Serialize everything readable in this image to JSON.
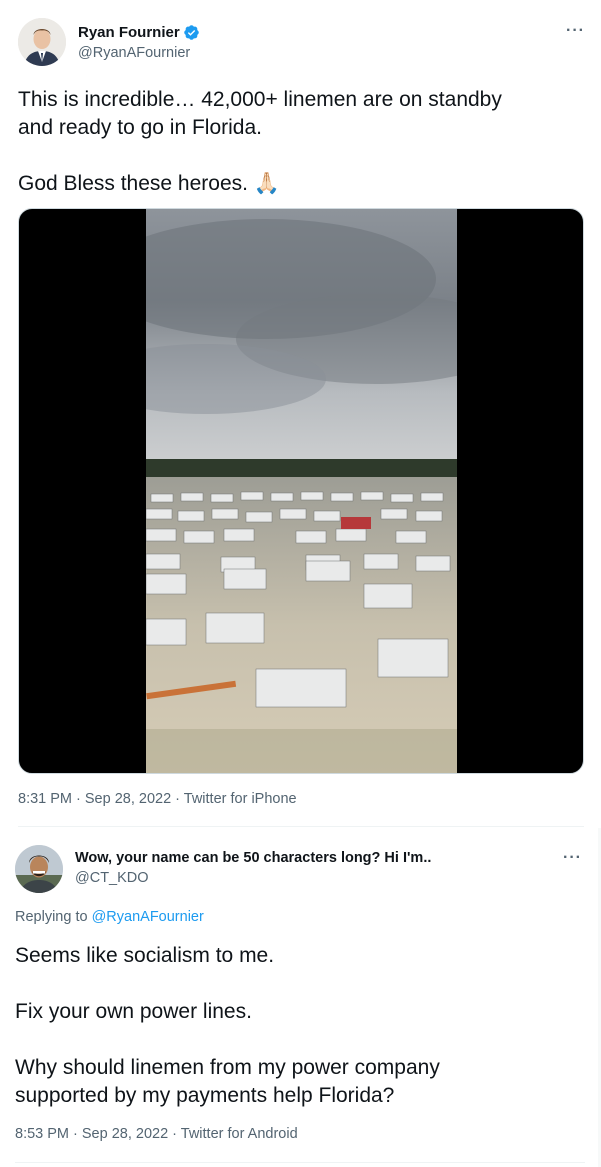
{
  "tweet1": {
    "author_name": "Ryan Fournier",
    "author_handle": "@RyanAFournier",
    "more_label": "···",
    "text_line1": "This is incredible… 42,000+ linemen are on standby",
    "text_line2": "and ready to go in Florida.",
    "text_line3": "God Bless these heroes. 🙏🏻",
    "timestamp": "8:31 PM · Sep 28, 2022 · Twitter for iPhone"
  },
  "tweet2": {
    "author_name": "Wow, your name can be 50 characters long? Hi I'm..",
    "author_handle": "@CT_KDO",
    "more_label": "···",
    "replying_prefix": "Replying to ",
    "replying_handle": "@RyanAFournier",
    "text_p1": "Seems like socialism to me.",
    "text_p2": "Fix your own power lines.",
    "text_p3_line1": "Why should linemen from my power company",
    "text_p3_line2": "supported by my payments help Florida?",
    "timestamp": "8:53 PM · Sep 28, 2022 · Twitter for Android"
  },
  "colors": {
    "text_primary": "#0f1419",
    "text_secondary": "#536471",
    "link": "#1d9bf0",
    "verified": "#1d9bf0",
    "divider": "#eff3f4"
  },
  "icons": {
    "verified": "verified-badge-icon",
    "more": "more-options-icon"
  }
}
